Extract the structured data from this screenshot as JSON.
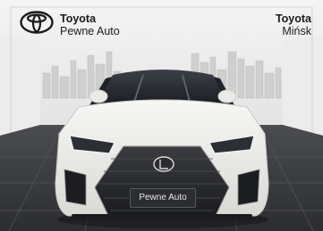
{
  "image": {
    "description_icon": "car-photo"
  },
  "header": {
    "brand_logo": "toyota-logo-icon",
    "dealer_brand": "Toyota",
    "dealer_name": "Pewne Auto",
    "location_brand": "Toyota",
    "location_city": "Mińsk"
  },
  "car": {
    "plate_text": "Pewne Auto",
    "body_color": "#e9e9e6",
    "floor_color": "#3a3c40"
  }
}
